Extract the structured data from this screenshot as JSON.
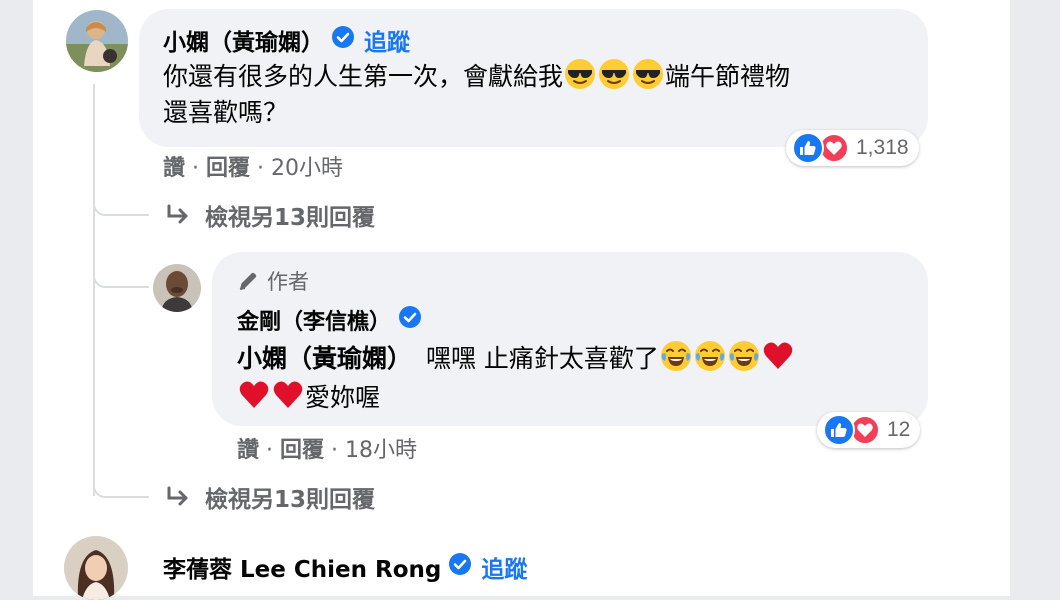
{
  "comment1": {
    "author_name": "小嫻（黃瑜嫻）",
    "follow_label": "追蹤",
    "text_part1": "你還有很多的人生第一次，會獻給我",
    "emojis": [
      "sunglasses-face",
      "sunglasses-face",
      "sunglasses-face"
    ],
    "text_part2": "端午節禮物",
    "text_line2": "還喜歡嗎？",
    "reaction_count": "1,318",
    "like_label": "讚",
    "reply_label": "回覆",
    "time": "20小時"
  },
  "view_more_1": "檢視另13則回覆",
  "reply1": {
    "author_tag": "作者",
    "author_name": "金剛（李信樵）",
    "mention": "小嫻（黃瑜嫻）",
    "text_part1": "嘿嘿 止痛針太喜歡了",
    "emojis_line1": [
      "tears-of-joy",
      "tears-of-joy",
      "tears-of-joy",
      "red-heart"
    ],
    "emojis_line2": [
      "red-heart",
      "red-heart"
    ],
    "text_part2": "愛妳喔",
    "reaction_count": "12",
    "like_label": "讚",
    "reply_label": "回覆",
    "time": "18小時"
  },
  "view_more_2": "檢視另13則回覆",
  "comment2": {
    "author_name": "李蒨蓉 Lee Chien Rong",
    "follow_label": "追蹤"
  },
  "colors": {
    "link_blue": "#1877f2",
    "bubble_bg": "#f0f2f5",
    "secondary_text": "#65676b",
    "like_blue": "#1877f2",
    "love_red": "#f33e58"
  }
}
